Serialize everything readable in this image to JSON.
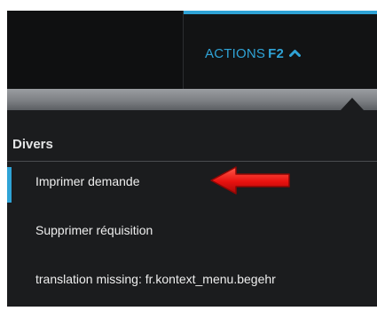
{
  "toolbar": {
    "actions_label": "ACTIONS",
    "actions_shortcut": "F2",
    "accent_color": "#2fa3d6"
  },
  "menu": {
    "section_title": "Divers",
    "items": [
      {
        "label": "Imprimer demande",
        "active": true
      },
      {
        "label": "Supprimer réquisition",
        "active": false
      },
      {
        "label": "translation missing: fr.kontext_menu.begehr",
        "active": false
      }
    ]
  },
  "annotation": {
    "arrow_color": "#e8110f",
    "points_to": "Imprimer demande"
  }
}
